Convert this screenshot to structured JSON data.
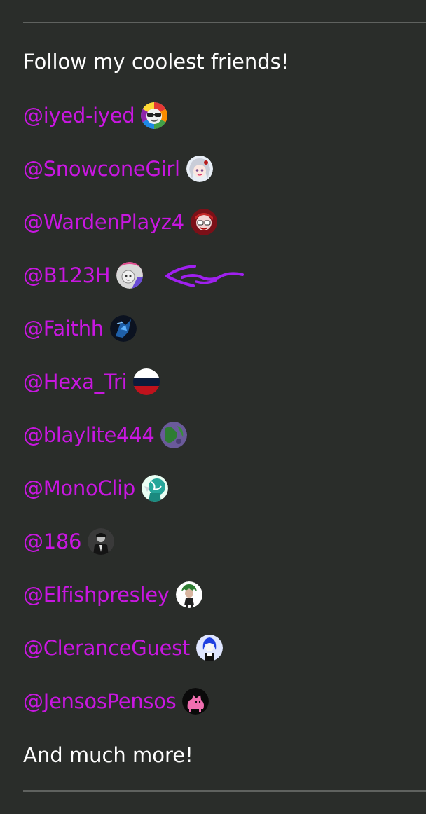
{
  "intro_text": "Follow my coolest friends!",
  "outro_text": "And much more!",
  "colors": {
    "background": "#2a2d2a",
    "link": "#c817e0",
    "text": "#ffffff",
    "divider": "#5f625f",
    "annotation": "#a020f0"
  },
  "friends": [
    {
      "handle": "@iyed-iyed",
      "avatar_icon": "rainbow-sunglasses-avatar-icon"
    },
    {
      "handle": "@SnowconeGirl",
      "avatar_icon": "anime-girl-avatar-icon"
    },
    {
      "handle": "@WardenPlayz4",
      "avatar_icon": "red-character-avatar-icon"
    },
    {
      "handle": "@B123H",
      "avatar_icon": "pink-grey-avatar-icon"
    },
    {
      "handle": "@Faithh",
      "avatar_icon": "dark-blue-avatar-icon"
    },
    {
      "handle": "@Hexa_Tri",
      "avatar_icon": "russian-flag-avatar-icon"
    },
    {
      "handle": "@blaylite444",
      "avatar_icon": "purple-green-avatar-icon"
    },
    {
      "handle": "@MonoClip",
      "avatar_icon": "teal-globe-avatar-icon"
    },
    {
      "handle": "@186",
      "avatar_icon": "suited-man-avatar-icon"
    },
    {
      "handle": "@Elfishpresley",
      "avatar_icon": "green-hair-character-avatar-icon"
    },
    {
      "handle": "@CleranceGuest",
      "avatar_icon": "blue-hair-character-avatar-icon"
    },
    {
      "handle": "@JensosPensos",
      "avatar_icon": "pink-cat-avatar-icon"
    }
  ]
}
